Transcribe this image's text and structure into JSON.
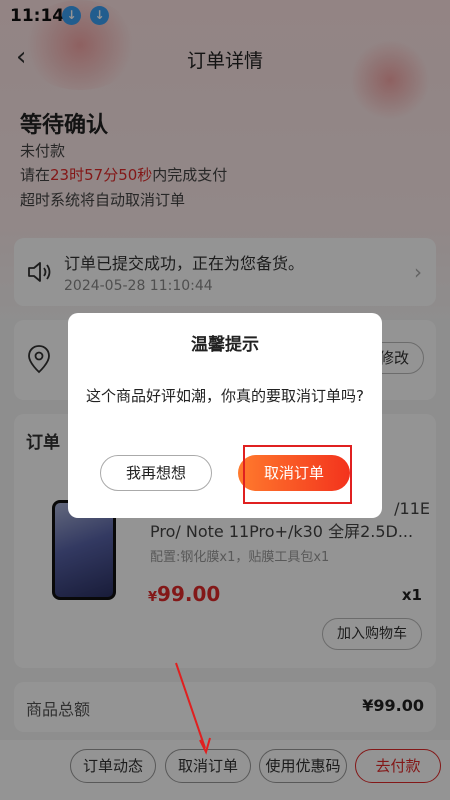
{
  "status_bar": {
    "time": "11:14",
    "icons": [
      "download-icon",
      "download-icon"
    ]
  },
  "nav": {
    "title": "订单详情",
    "back_icon": "chevron-left-icon"
  },
  "order_status": {
    "heading": "等待确认",
    "payment_state": "未付款",
    "countdown_prefix": "请在",
    "countdown": "23时57分50秒",
    "countdown_suffix": "内完成支付",
    "timeout_note": "超时系统将自动取消订单"
  },
  "notice": {
    "message": "订单已提交成功，正在为您备货。",
    "timestamp": "2024-05-28 11:10:44"
  },
  "address": {
    "edit_label": "修改"
  },
  "order_info": {
    "section_title": "订单",
    "product_name_line1": "/11E",
    "product_name_line2": "Pro/ Note 11Pro+/k30 全屏2.5D...",
    "config": "配置:钢化膜x1，贴膜工具包x1",
    "price_symbol": "¥",
    "price": "99.00",
    "quantity": "x1",
    "add_to_cart_label": "加入购物车"
  },
  "summary": {
    "label": "商品总额",
    "value": "¥99.00"
  },
  "bottom_bar": {
    "buttons": [
      "订单动态",
      "取消订单",
      "使用优惠码",
      "去付款"
    ]
  },
  "dialog": {
    "title": "温馨提示",
    "message": "这个商品好评如潮，你真的要取消订单吗?",
    "keep_label": "我再想想",
    "cancel_label": "取消订单"
  },
  "colors": {
    "accent": "#e22a2a",
    "button_gradient_start": "#ff7a2d",
    "button_gradient_end": "#f3331d"
  }
}
